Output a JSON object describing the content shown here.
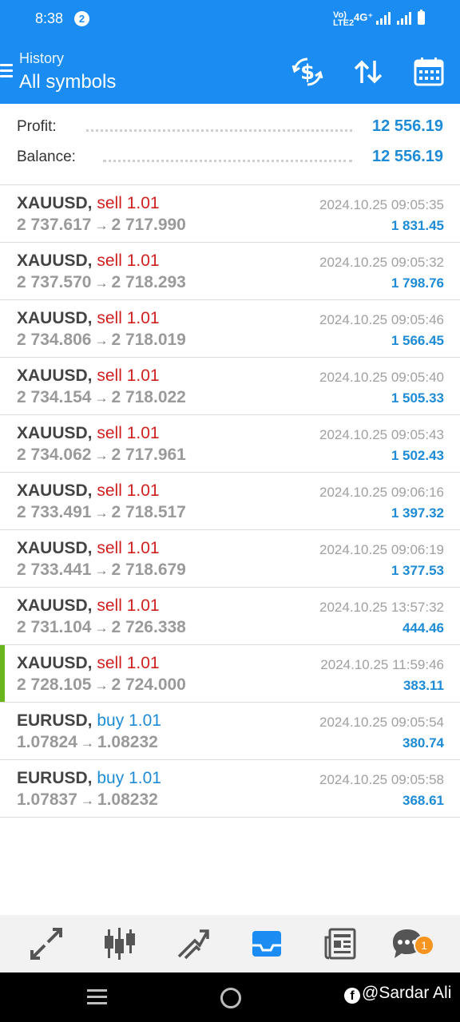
{
  "status": {
    "time": "8:38",
    "notification_count": "2",
    "network": "4G⁺",
    "volte": "Vo) LTE2"
  },
  "header": {
    "subtitle": "History",
    "title": "All symbols",
    "bg_color": "#1a8cf2",
    "actions": [
      "currency-exchange-icon",
      "sort-icon",
      "calendar-icon"
    ]
  },
  "summary": {
    "profit_label": "Profit:",
    "profit_value": "12 556.19",
    "balance_label": "Balance:",
    "balance_value": "12 556.19"
  },
  "deals": [
    {
      "symbol": "XAUUSD,",
      "side": "sell",
      "volume": "1.01",
      "open": "2 737.617",
      "close": "2 717.990",
      "time": "2024.10.25 09:05:35",
      "profit": "1 831.45"
    },
    {
      "symbol": "XAUUSD,",
      "side": "sell",
      "volume": "1.01",
      "open": "2 737.570",
      "close": "2 718.293",
      "time": "2024.10.25 09:05:32",
      "profit": "1 798.76"
    },
    {
      "symbol": "XAUUSD,",
      "side": "sell",
      "volume": "1.01",
      "open": "2 734.806",
      "close": "2 718.019",
      "time": "2024.10.25 09:05:46",
      "profit": "1 566.45"
    },
    {
      "symbol": "XAUUSD,",
      "side": "sell",
      "volume": "1.01",
      "open": "2 734.154",
      "close": "2 718.022",
      "time": "2024.10.25 09:05:40",
      "profit": "1 505.33"
    },
    {
      "symbol": "XAUUSD,",
      "side": "sell",
      "volume": "1.01",
      "open": "2 734.062",
      "close": "2 717.961",
      "time": "2024.10.25 09:05:43",
      "profit": "1 502.43"
    },
    {
      "symbol": "XAUUSD,",
      "side": "sell",
      "volume": "1.01",
      "open": "2 733.491",
      "close": "2 718.517",
      "time": "2024.10.25 09:06:16",
      "profit": "1 397.32"
    },
    {
      "symbol": "XAUUSD,",
      "side": "sell",
      "volume": "1.01",
      "open": "2 733.441",
      "close": "2 718.679",
      "time": "2024.10.25 09:06:19",
      "profit": "1 377.53"
    },
    {
      "symbol": "XAUUSD,",
      "side": "sell",
      "volume": "1.01",
      "open": "2 731.104",
      "close": "2 726.338",
      "time": "2024.10.25 13:57:32",
      "profit": "444.46"
    },
    {
      "symbol": "XAUUSD,",
      "side": "sell",
      "volume": "1.01",
      "open": "2 728.105",
      "close": "2 724.000",
      "time": "2024.10.25 11:59:46",
      "profit": "383.11",
      "selected": true
    },
    {
      "symbol": "EURUSD,",
      "side": "buy",
      "volume": "1.01",
      "open": "1.07824",
      "close": "1.08232",
      "time": "2024.10.25 09:05:54",
      "profit": "380.74"
    },
    {
      "symbol": "EURUSD,",
      "side": "buy",
      "volume": "1.01",
      "open": "1.07837",
      "close": "1.08232",
      "time": "2024.10.25 09:05:58",
      "profit": "368.61"
    }
  ],
  "colors": {
    "sell": "#d11f1f",
    "buy": "#1d8bd6",
    "profit": "#1d8bd6",
    "selected_marker": "#6ab51e"
  },
  "bottom_nav": {
    "items": [
      "quotes-icon",
      "chart-icon",
      "trade-icon",
      "history-icon",
      "news-icon",
      "chat-icon"
    ],
    "active": "history-icon",
    "chat_badge": "1"
  },
  "watermark": "@Sardar Ali"
}
